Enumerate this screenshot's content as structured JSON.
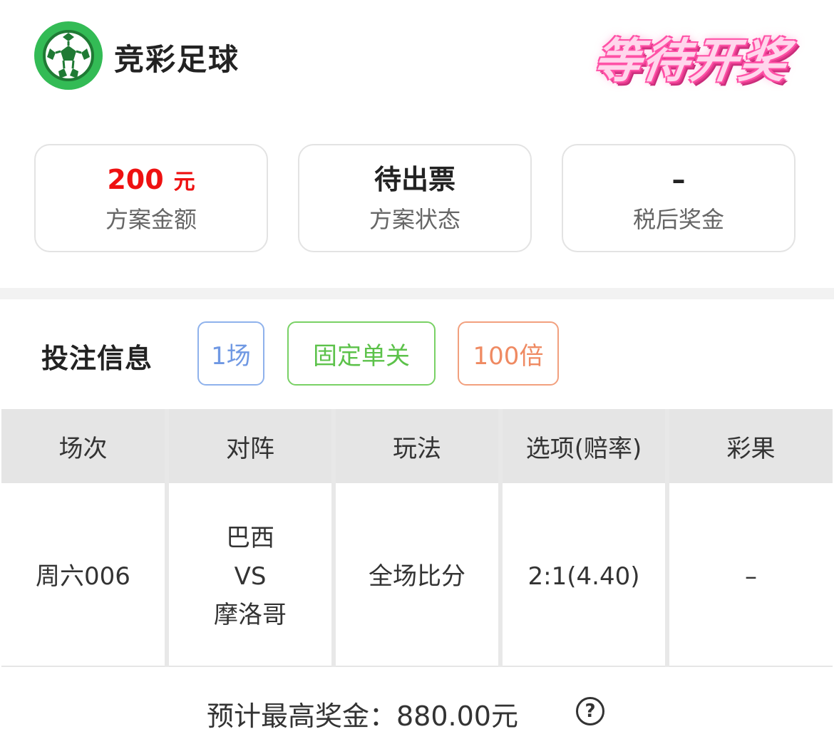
{
  "header": {
    "app_title": "竞彩足球",
    "status_stamp": "等待开奖",
    "logo_icon": "soccer-ball-icon",
    "brand_color": "#33bb55"
  },
  "summary": {
    "amount": {
      "value": "200",
      "unit": "元",
      "label": "方案金额",
      "color": "#ee1111"
    },
    "status": {
      "value": "待出票",
      "label": "方案状态"
    },
    "prize": {
      "value": "–",
      "label": "税后奖金"
    }
  },
  "bet_info": {
    "title": "投注信息",
    "tags": [
      {
        "label": "1场",
        "color": "#6f98e3"
      },
      {
        "label": "固定单关",
        "color": "#5cc24a"
      },
      {
        "label": "100倍",
        "color": "#ef8a62"
      }
    ]
  },
  "table": {
    "headers": [
      "场次",
      "对阵",
      "玩法",
      "选项(赔率)",
      "彩果"
    ],
    "rows": [
      {
        "match_no": "周六006",
        "home": "巴西",
        "vs": "VS",
        "away": "摩洛哥",
        "play_type": "全场比分",
        "option": "2:1(4.40)",
        "result": "–"
      }
    ]
  },
  "footer": {
    "max_prize": "预计最高奖金：880.00元",
    "help_icon": "question-circle-icon"
  }
}
